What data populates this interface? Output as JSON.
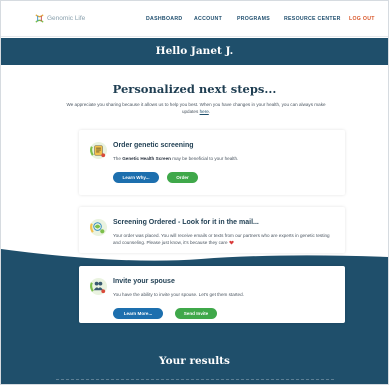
{
  "brand": {
    "name": "Genomic Life",
    "colors": {
      "primary": "#1f4f6b",
      "accent": "#d9582b",
      "blue_button": "#1d6fae",
      "green_button": "#3fa84a"
    }
  },
  "nav": {
    "items": [
      {
        "label": "DASHBOARD"
      },
      {
        "label": "ACCOUNT"
      },
      {
        "label": "PROGRAMS"
      },
      {
        "label": "RESOURCE CENTER"
      },
      {
        "label": "LOG OUT"
      }
    ]
  },
  "greeting": "Hello Janet J.",
  "next_steps": {
    "title": "Personalized next steps...",
    "intro": "We appreciate you sharing because it allows us to help you best. When you have changes in your health, you can always make updates",
    "intro_link": "here",
    "intro_end": "."
  },
  "cards": [
    {
      "title": "Order genetic screening",
      "text_prefix": "The",
      "text_bold": "Genetic Health Screen",
      "text_suffix": "may be beneficial to your health.",
      "icon": "screening-kit-icon",
      "buttons": [
        {
          "label": "Learn Why..."
        },
        {
          "label": "Order"
        }
      ]
    },
    {
      "title": "Screening Ordered - Look for it in the mail...",
      "text": "Your order was placed. You will receive emails or texts from our partners who are experts in genetic testing and counseling. Please just know, it's because they care",
      "icon": "dna-icon"
    },
    {
      "title": "Invite your spouse",
      "text": "You have the ability to invite your spouse. Let's get them started.",
      "icon": "family-icon",
      "buttons": [
        {
          "label": "Learn More..."
        },
        {
          "label": "Send Invite"
        }
      ]
    }
  ],
  "results": {
    "title": "Your results"
  }
}
